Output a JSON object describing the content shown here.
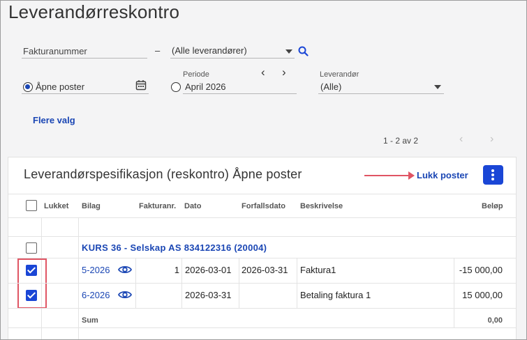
{
  "page": {
    "title": "Leverandørreskontro"
  },
  "filters": {
    "invoice_number_placeholder": "Fakturanummer",
    "range_dash": "–",
    "supplier_range_value": "(Alle leverandører)",
    "radio_open_label": "Åpne poster",
    "period_label": "Periode",
    "period_value": "April 2026",
    "supplier_label": "Leverandør",
    "supplier_value": "(Alle)",
    "more_options": "Flere valg",
    "prev_glyph": "‹",
    "next_glyph": "›"
  },
  "pager": {
    "text": "1 - 2 av 2",
    "prev": "‹",
    "next": "›"
  },
  "card": {
    "title": "Leverandørspesifikasjon (reskontro) Åpne poster",
    "close_button": "Lukk poster"
  },
  "table": {
    "headers": {
      "closed": "Lukket",
      "voucher": "Bilag",
      "invoice_no": "Fakturanr.",
      "date": "Dato",
      "due_date": "Forfallsdato",
      "description": "Beskrivelse",
      "amount": "Beløp"
    },
    "group": {
      "title": "KURS 36 - Selskap AS 834122316 (20004)"
    },
    "rows": [
      {
        "voucher": "5-2026",
        "invoice_no": "1",
        "date": "2026-03-01",
        "due_date": "2026-03-31",
        "description": "Faktura1",
        "amount": "-15 000,00",
        "checked": true
      },
      {
        "voucher": "6-2026",
        "invoice_no": "",
        "date": "2026-03-31",
        "due_date": "",
        "description": "Betaling faktura 1",
        "amount": "15 000,00",
        "checked": true
      }
    ],
    "sum": {
      "label": "Sum",
      "amount": "0,00"
    }
  },
  "colors": {
    "accent": "#1a46b4",
    "button": "#1a46d6",
    "annotation": "#e05564"
  }
}
